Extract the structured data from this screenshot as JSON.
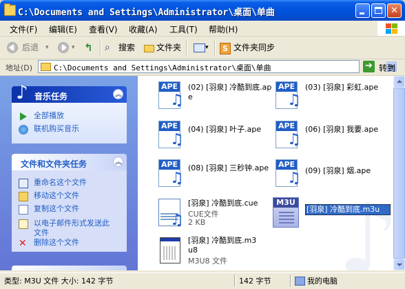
{
  "window": {
    "title": "C:\\Documents and Settings\\Administrator\\桌面\\单曲"
  },
  "menu": [
    "文件(F)",
    "编辑(E)",
    "查看(V)",
    "收藏(A)",
    "工具(T)",
    "帮助(H)"
  ],
  "toolbar": {
    "back": "后退",
    "search": "搜索",
    "folders": "文件夹",
    "sync": "文件夹同步"
  },
  "address": {
    "label": "地址(D)",
    "path": "C:\\Documents and Settings\\Administrator\\桌面\\单曲",
    "go": "转到"
  },
  "music_tasks": {
    "title": "音乐任务",
    "items": [
      "全部播放",
      "联机购买音乐"
    ]
  },
  "file_tasks": {
    "title": "文件和文件夹任务",
    "items": [
      "重命名这个文件",
      "移动这个文件",
      "复制这个文件",
      "以电子邮件形式发送此文件",
      "删除这个文件"
    ]
  },
  "files": [
    {
      "name": "(02) [羽泉] 冷酷到底.ape",
      "icon": "ape-file-icon",
      "badge": "APE"
    },
    {
      "name": "(03) [羽泉] 彩虹.ape",
      "icon": "ape-file-icon",
      "badge": "APE"
    },
    {
      "name": "(04) [羽泉] 叶子.ape",
      "icon": "ape-file-icon",
      "badge": "APE"
    },
    {
      "name": "(06) [羽泉] 我要.ape",
      "icon": "ape-file-icon",
      "badge": "APE"
    },
    {
      "name": "(08) [羽泉] 三秒钟.ape",
      "icon": "ape-file-icon",
      "badge": "APE"
    },
    {
      "name": "(09) [羽泉] 烟.ape",
      "icon": "ape-file-icon",
      "badge": "APE"
    },
    {
      "name": "[羽泉] 冷酷到底.cue",
      "type": "CUE文件",
      "size": "2 KB",
      "icon": "cue-file-icon"
    },
    {
      "name": "[羽泉] 冷酷到底.m3u",
      "icon": "m3u-file-icon",
      "badge": "M3U",
      "selected": true
    },
    {
      "name": "[羽泉] 冷酷到底.m3u8",
      "type": "M3U8 文件",
      "icon": "m3u8-file-icon"
    }
  ],
  "status": {
    "info": "类型: M3U 文件 大小: 142 字节",
    "size": "142 字节",
    "location": "我的电脑"
  },
  "colors": {
    "titlebar": "#0355e0",
    "selection": "#316ac5",
    "link": "#215dc6"
  }
}
